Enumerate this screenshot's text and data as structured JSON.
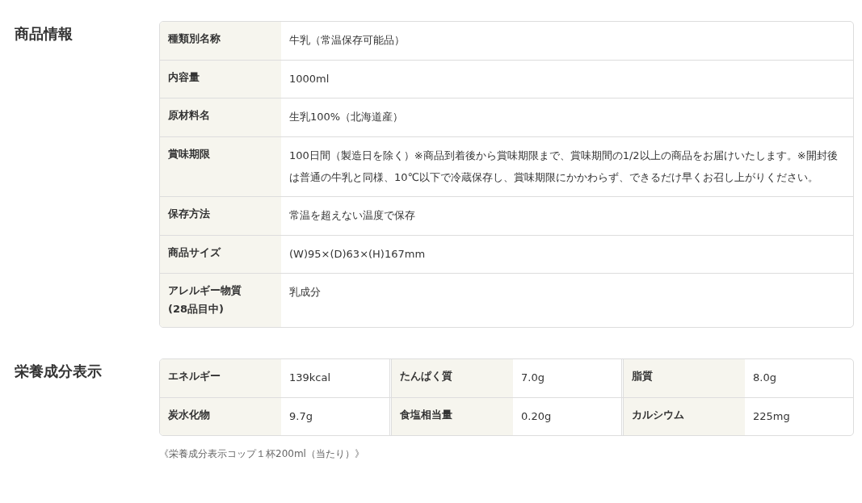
{
  "product_info": {
    "heading": "商品情報",
    "rows": [
      {
        "label": "種類別名称",
        "value": "牛乳（常温保存可能品）"
      },
      {
        "label": "内容量",
        "value": "1000ml"
      },
      {
        "label": "原材料名",
        "value": "生乳100%（北海道産）"
      },
      {
        "label": "賞味期限",
        "value": "100日間（製造日を除く）※商品到着後から賞味期限まで、賞味期間の1/2以上の商品をお届けいたします。※開封後は普通の牛乳と同様、10℃以下で冷蔵保存し、賞味期限にかかわらず、できるだけ早くお召し上がりください。"
      },
      {
        "label": "保存方法",
        "value": "常温を超えない温度で保存"
      },
      {
        "label": "商品サイズ",
        "value": "(W)95×(D)63×(H)167mm"
      },
      {
        "label": "アレルギー物質\n(28品目中)",
        "value": "乳成分"
      }
    ]
  },
  "nutrition": {
    "heading": "栄養成分表示",
    "rows": [
      [
        {
          "label": "エネルギー",
          "value": "139kcal"
        },
        {
          "label": "たんぱく質",
          "value": "7.0g"
        },
        {
          "label": "脂質",
          "value": "8.0g"
        }
      ],
      [
        {
          "label": "炭水化物",
          "value": "9.7g"
        },
        {
          "label": "食塩相当量",
          "value": "0.20g"
        },
        {
          "label": "カルシウム",
          "value": "225mg"
        }
      ]
    ],
    "note": "《栄養成分表示コップ１杯200ml（当たり）》"
  }
}
